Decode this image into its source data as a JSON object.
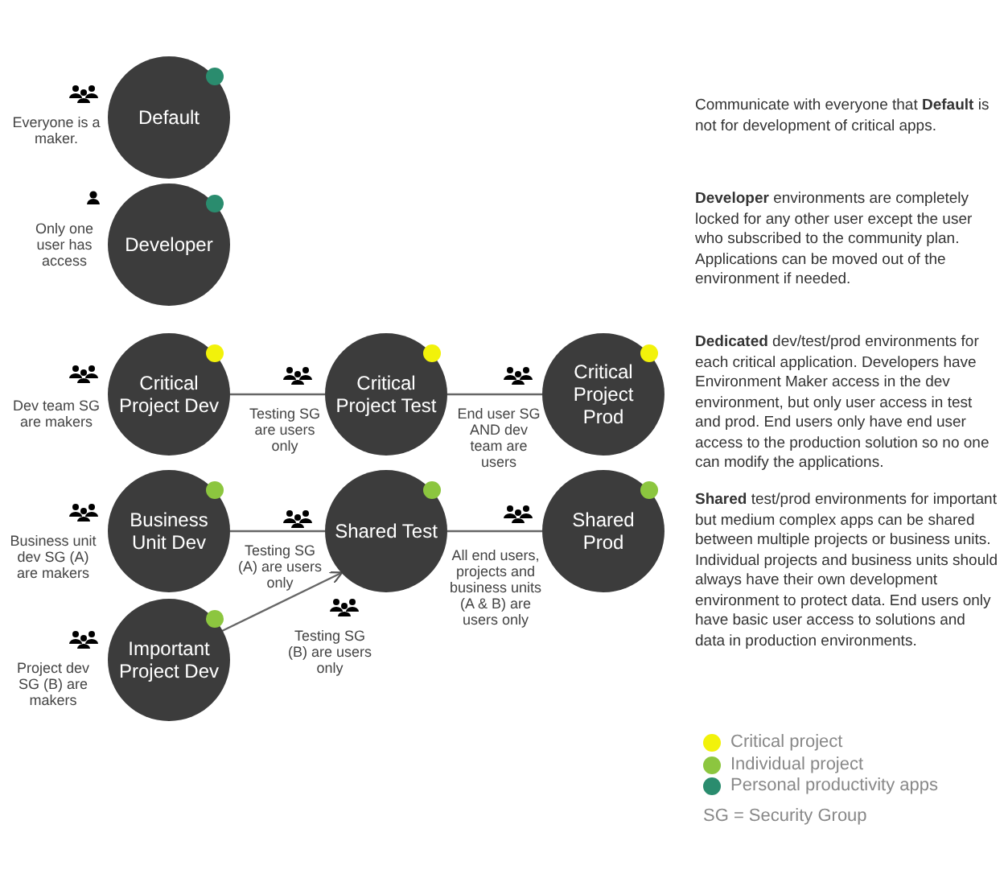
{
  "nodes": [
    {
      "label": "Default",
      "color": "#2a8c6e",
      "note": {
        "kind": "group",
        "text": "Everyone is a maker."
      }
    },
    {
      "label": "Developer",
      "color": "#2a8c6e",
      "note": {
        "kind": "person",
        "text": "Only one user has access"
      }
    },
    {
      "label": "Critical Project Dev",
      "color": "#f2f20a",
      "note": {
        "kind": "group",
        "text": "Dev team SG are makers"
      }
    },
    {
      "label": "Critical Project Test",
      "color": "#f2f20a"
    },
    {
      "label": "Critical Project Prod",
      "color": "#f2f20a"
    },
    {
      "label": "Business Unit Dev",
      "color": "#8cc63f",
      "note": {
        "kind": "group",
        "text": "Business unit dev SG (A) are makers"
      }
    },
    {
      "label": "Shared Test",
      "color": "#8cc63f"
    },
    {
      "label": "Shared Prod",
      "color": "#8cc63f"
    },
    {
      "label": "Important Project Dev",
      "color": "#8cc63f",
      "note": {
        "kind": "group",
        "text": "Project dev SG (B) are makers"
      }
    }
  ],
  "edges": [
    {
      "kind": "line",
      "label": "Testing SG are users only"
    },
    {
      "kind": "line",
      "label": "End user SG AND dev team are users"
    },
    {
      "kind": "line",
      "label": "Testing SG (A) are users only"
    },
    {
      "kind": "line",
      "label": "All end users, projects and business units (A & B) are users only"
    },
    {
      "kind": "arrow",
      "label": "Testing SG (B) are users only"
    }
  ],
  "descriptions": [
    "Communicate with everyone that **Default** is not for development of critical apps.",
    "**Developer** environments are completely locked for any other user except the user who subscribed to the community plan. Applications can be moved out of the environment if needed.",
    "**Dedicated** dev/test/prod environments for each critical application. Developers have Environment Maker access in the dev environment, but only user access in test and prod. End users only have end user access to the production solution so no one can modify the applications.",
    "**Shared** test/prod environments for important but medium complex apps can be shared between multiple projects or business units.\nIndividual projects and business units should always have their own development environment to protect data. End users only have basic user access to solutions and data in production environments."
  ],
  "legend": [
    {
      "label": "Critical project",
      "color": "#f2f20a"
    },
    {
      "label": "Individual project",
      "color": "#8cc63f"
    },
    {
      "label": "Personal productivity apps",
      "color": "#2a8c6e"
    }
  ],
  "footnote": "SG = Security Group"
}
